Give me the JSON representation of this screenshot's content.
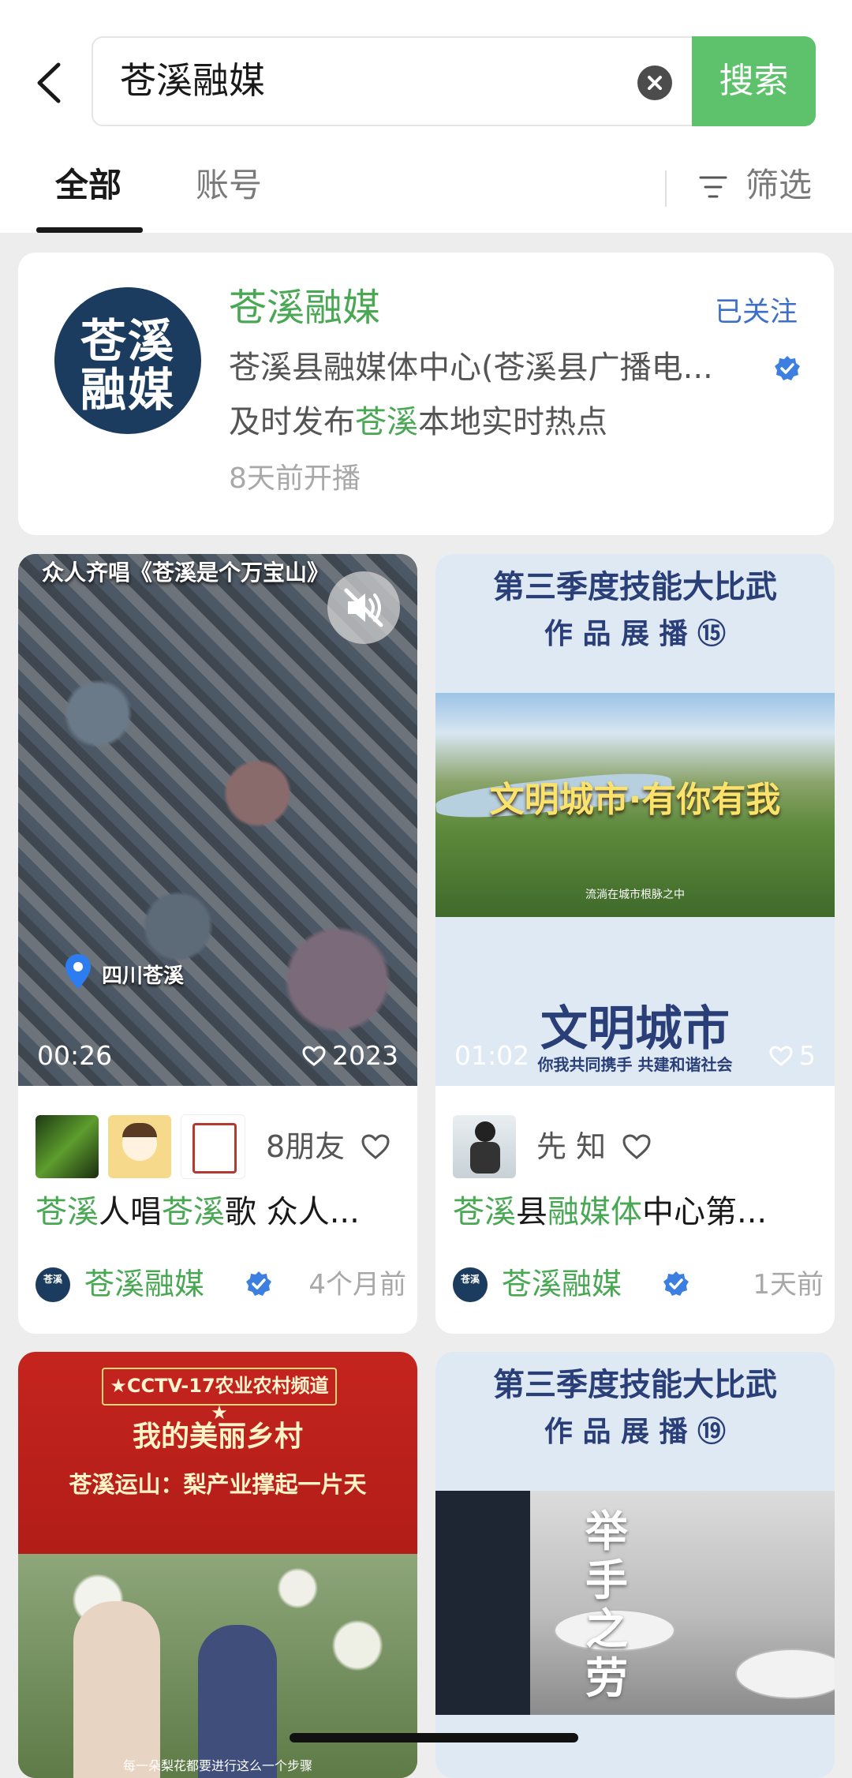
{
  "search": {
    "query": "苍溪融媒",
    "button_label": "搜索"
  },
  "tabs": [
    {
      "label": "全部",
      "active": true
    },
    {
      "label": "账号",
      "active": false
    }
  ],
  "filter_label": "筛选",
  "account": {
    "name": "苍溪融媒",
    "avatar_line1": "苍溪",
    "avatar_line2": "融媒",
    "follow_status": "已关注",
    "description": "苍溪县融媒体中心(苍溪县广播电...",
    "slogan_pre": "及时发布",
    "slogan_hl": "苍溪",
    "slogan_post": "本地实时热点",
    "live_info": "8天前开播"
  },
  "videos": [
    {
      "overlay_title": "众人齐唱《苍溪是个万宝山》",
      "location": "四川苍溪",
      "duration": "00:26",
      "likes": "2023",
      "friends_text": "8朋友",
      "title_parts": [
        {
          "t": "苍溪",
          "hl": true
        },
        {
          "t": "人唱",
          "hl": false
        },
        {
          "t": "苍溪",
          "hl": true
        },
        {
          "t": "歌 众人...",
          "hl": false
        }
      ],
      "author": "苍溪融媒",
      "time": "4个月前"
    },
    {
      "overlay_title": "第三季度技能大比武",
      "overlay_sub": "作 品 展 播 ⑮",
      "banner_text": "文明城市·有你有我",
      "banner_caption": "流淌在城市根脉之中",
      "bottom_big": "文明城市",
      "bottom_small": "你我共同携手 共建和谐社会",
      "duration": "01:02",
      "likes": "5",
      "friends_text": "先 知",
      "title_parts": [
        {
          "t": "苍溪",
          "hl": true
        },
        {
          "t": "县",
          "hl": false
        },
        {
          "t": "融媒体",
          "hl": true
        },
        {
          "t": "中心第...",
          "hl": false
        }
      ],
      "author": "苍溪融媒",
      "time": "1天前"
    },
    {
      "channel": "★CCTV-17农业农村频道★",
      "overlay_title": "我的美丽乡村",
      "overlay_sub": "苍溪运山：梨产业撑起一片天",
      "caption": "每一朵梨花都要进行这么一个步骤"
    },
    {
      "overlay_title": "第三季度技能大比武",
      "overlay_sub": "作 品 展 播 ⑲",
      "calligraphy": "举手之劳"
    }
  ],
  "colors": {
    "accent_green": "#5ec16b",
    "link_green": "#4aa855",
    "follow_blue": "#3d6fc8",
    "avatar_navy": "#1b3c5f"
  }
}
